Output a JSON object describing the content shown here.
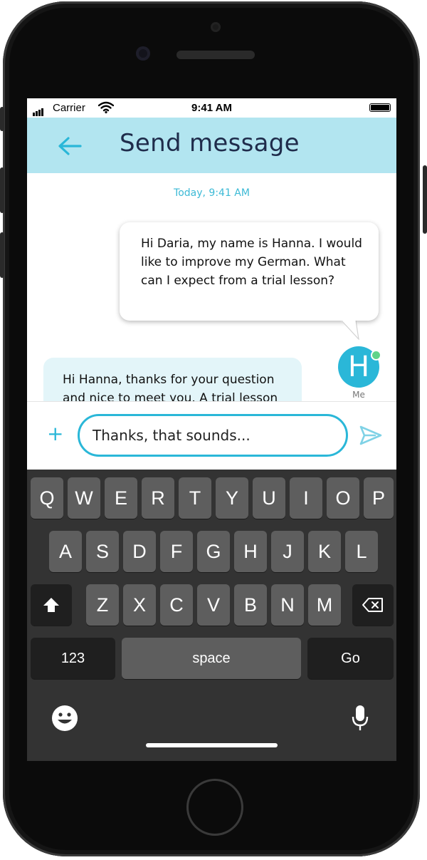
{
  "status_bar": {
    "carrier": "Carrier",
    "time": "9:41 AM"
  },
  "header": {
    "title": "Send message",
    "back_icon": "arrow-left-icon"
  },
  "chat": {
    "timestamp": "Today, 9:41 AM",
    "outgoing_message": "Hi Daria, my name is Hanna. I would like to improve my German. What can I expect from a trial lesson?",
    "incoming_message": "Hi Hanna, thanks for your question and nice to meet you. A trial lesson",
    "avatar_initial": "H",
    "avatar_label": "Me",
    "avatar_status_color": "#5fd48a"
  },
  "composer": {
    "plus_label": "+",
    "input_value": "Thanks, that sounds...",
    "send_icon": "send-icon"
  },
  "keyboard": {
    "row1": [
      "Q",
      "W",
      "E",
      "R",
      "T",
      "Y",
      "U",
      "I",
      "O",
      "P"
    ],
    "row2": [
      "A",
      "S",
      "D",
      "F",
      "G",
      "H",
      "J",
      "K",
      "L"
    ],
    "row3": [
      "Z",
      "X",
      "C",
      "V",
      "B",
      "N",
      "M"
    ],
    "numbers_label": "123",
    "space_label": "space",
    "go_label": "Go",
    "shift_icon": "shift-icon",
    "backspace_icon": "backspace-icon",
    "emoji_icon": "emoji-icon",
    "mic_icon": "microphone-icon"
  },
  "colors": {
    "accent": "#2ab7d8",
    "header_bg": "#b2e5f0",
    "title_text": "#1f2c4b",
    "incoming_bubble": "#e3f5f9",
    "keyboard_bg": "#333333",
    "key_bg": "#5e5e5e"
  }
}
